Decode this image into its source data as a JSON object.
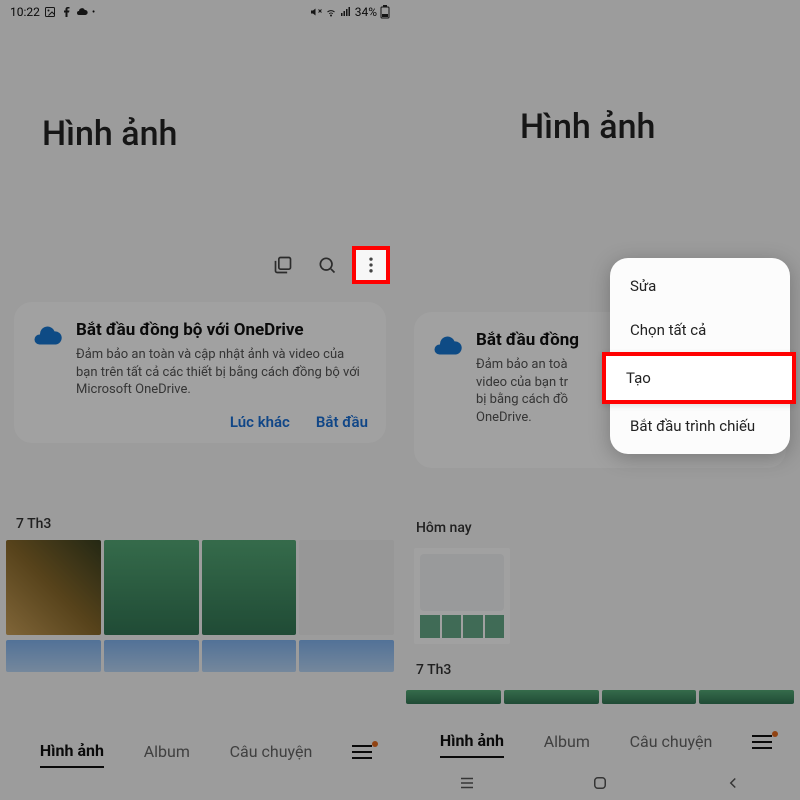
{
  "statusbar": {
    "time": "10:22",
    "battery": "34%"
  },
  "title": "Hình ảnh",
  "onedrive_card": {
    "title": "Bắt đầu đồng bộ với OneDrive",
    "title_truncated": "Bắt đầu đồng",
    "desc": "Đảm bảo an toàn và cập nhật ảnh và video của bạn trên tất cả các thiết bị bằng cách đồng bộ với Microsoft OneDrive.",
    "desc_truncated": "Đảm bảo an toàn video của bạn tr bị bằng cách đồ OneDrive.",
    "later": "Lúc khác",
    "start": "Bắt đầu"
  },
  "sections": {
    "date_7th3": "7 Th3",
    "today": "Hôm nay"
  },
  "tabs": {
    "photos": "Hình ảnh",
    "albums": "Album",
    "stories": "Câu chuyện"
  },
  "popup": {
    "edit": "Sửa",
    "select_all": "Chọn tất cả",
    "create": "Tạo",
    "slideshow": "Bắt đầu trình chiếu"
  }
}
